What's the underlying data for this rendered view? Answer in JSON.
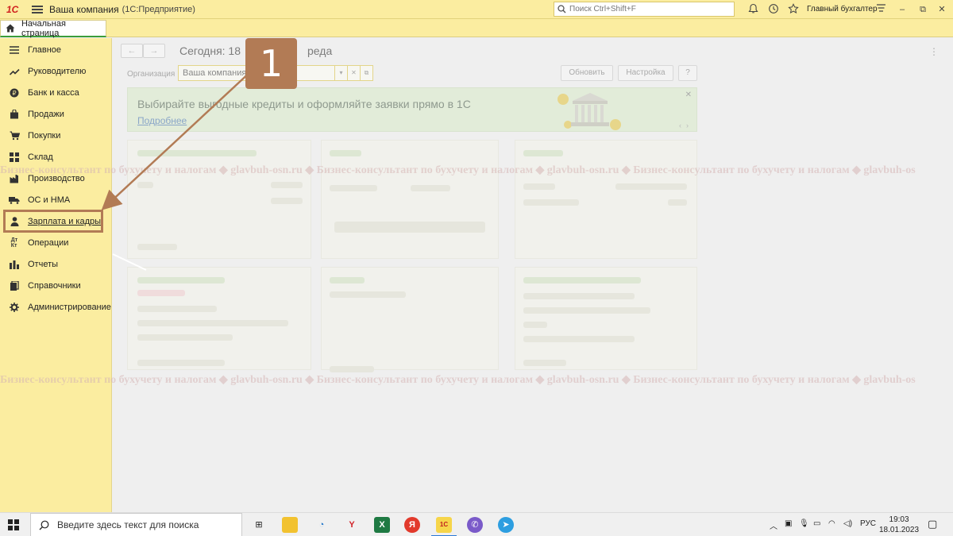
{
  "app": {
    "title": "Ваша компания",
    "subtitle": "(1С:Предприятие)",
    "search_placeholder": "Поиск Ctrl+Shift+F",
    "user": "Главный бухгалтер"
  },
  "tabs": {
    "home": "Начальная страница"
  },
  "sidebar": {
    "items": [
      {
        "label": "Главное",
        "icon": "list-icon"
      },
      {
        "label": "Руководителю",
        "icon": "trend-icon"
      },
      {
        "label": "Банк и касса",
        "icon": "ruble-coin-icon"
      },
      {
        "label": "Продажи",
        "icon": "bag-icon"
      },
      {
        "label": "Покупки",
        "icon": "cart-icon"
      },
      {
        "label": "Склад",
        "icon": "grid-icon"
      },
      {
        "label": "Производство",
        "icon": "factory-icon"
      },
      {
        "label": "ОС и НМА",
        "icon": "truck-icon"
      },
      {
        "label": "Зарплата и кадры",
        "icon": "person-icon"
      },
      {
        "label": "Операции",
        "icon": "dt-kt-icon"
      },
      {
        "label": "Отчеты",
        "icon": "bar-chart-icon"
      },
      {
        "label": "Справочники",
        "icon": "books-icon"
      },
      {
        "label": "Администрирование",
        "icon": "gear-icon"
      }
    ]
  },
  "main": {
    "title": "Сегодня: 18",
    "title_tail": "реда",
    "org_label": "Организация",
    "org_value": "Ваша компания",
    "refresh_label": "Обновить",
    "settings_label": "Настройка",
    "help_label": "?",
    "banner": {
      "headline": "Выбирайте выгодные кредиты и оформляйте заявки прямо в 1С",
      "link": "Подробнее"
    }
  },
  "callout": {
    "number": "1"
  },
  "watermark": {
    "text": "Бизнес-консультант по бухучету и налогам ◆ glavbuh-osn.ru ◆ Бизнес-консультант по бухучету и налогам ◆ glavbuh-osn.ru ◆ Бизнес-консультант по бухучету и налогам ◆ glavbuh-os"
  },
  "taskbar": {
    "search_placeholder": "Введите здесь текст для поиска",
    "lang": "РУС",
    "time": "19:03",
    "date": "18.01.2023"
  },
  "colors": {
    "sidebar_bg": "#fbeda0",
    "highlight_frame": "#b27b55",
    "active_tab_accent": "#3a9d3a"
  }
}
